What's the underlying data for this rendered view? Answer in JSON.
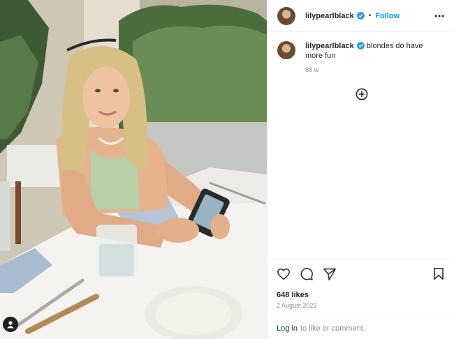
{
  "post": {
    "username": "lilypearlblack",
    "follow_label": "Follow",
    "separator": "•",
    "caption": "blondes do have more fun",
    "time_ago": "88 w",
    "likes": "648 likes",
    "date": "2 August 2022"
  },
  "footer": {
    "login_link": "Log in",
    "login_suffix": "to like or comment."
  },
  "icons": {
    "verified": "verified-badge-icon",
    "more": "more-options-icon",
    "load_more": "plus-circle-icon",
    "like": "heart-icon",
    "comment": "comment-icon",
    "share": "share-icon",
    "save": "bookmark-icon",
    "tag": "user-tag-icon"
  },
  "colors": {
    "accent": "#0095f6",
    "verified": "#3897f0",
    "muted": "#8e8e8e",
    "text": "#262626",
    "link": "#00376b"
  }
}
